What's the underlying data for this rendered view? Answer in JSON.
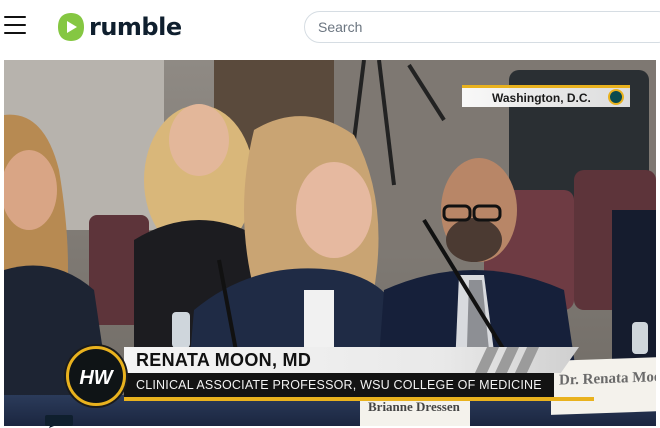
{
  "header": {
    "logo_text": "rumble",
    "search": {
      "placeholder": "Search",
      "value": ""
    }
  },
  "video": {
    "location": "Washington, D.C.",
    "speaker_name": "RENATA MOON, MD",
    "speaker_title": "CLINICAL ASSOCIATE PROFESSOR, WSU COLLEGE OF MEDICINE",
    "network_logo_text": "HW",
    "placard_right": "Dr. Renata Moo",
    "placard_front": "Brianne Dressen"
  },
  "colors": {
    "brand_green": "#85c742",
    "brand_dark": "#0f1f2e",
    "lower_third_gold": "#e9b21e"
  },
  "icons": [
    "menu-icon",
    "rumble-logo-icon",
    "channel-logo-icon",
    "location-dot-icon"
  ]
}
